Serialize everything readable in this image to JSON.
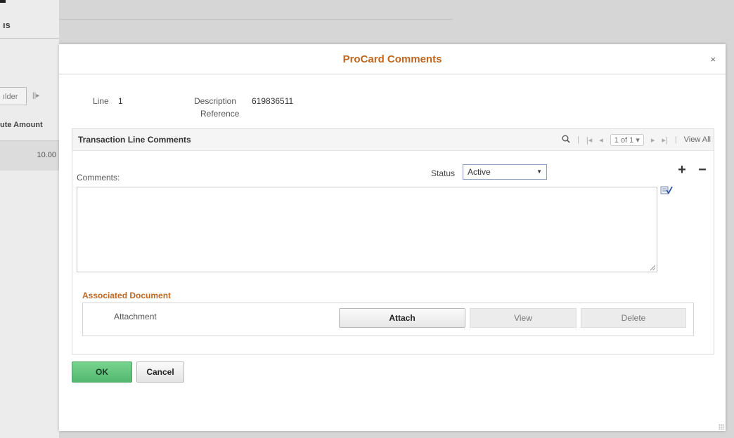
{
  "background": {
    "page_title": "ıs",
    "tab_label": "ılder",
    "tab_icon": "||▸",
    "column_header": "ute Amount",
    "row_value": "10.00"
  },
  "modal": {
    "title": "ProCard Comments",
    "close_glyph": "×",
    "line_label": "Line",
    "line_value": "1",
    "description_label": "Description",
    "description_value": "619836511",
    "reference_label": "Reference",
    "grid": {
      "title": "Transaction Line Comments",
      "pager": {
        "first": "|◂",
        "prev": "◂",
        "count": "1 of 1",
        "count_caret": "▾",
        "next": "▸",
        "last": "▸|",
        "view_all": "View All"
      },
      "comments_label": "Comments:",
      "status_label": "Status",
      "status_value": "Active",
      "status_caret": "▼",
      "add_glyph": "+",
      "delete_glyph": "−",
      "comments_value": ""
    },
    "associated_document": {
      "title": "Associated Document",
      "attachment_label": "Attachment",
      "attach_button": "Attach",
      "view_button": "View",
      "delete_button": "Delete"
    },
    "ok_button": "OK",
    "cancel_button": "Cancel"
  },
  "colors": {
    "title_accent": "#c0661e",
    "ok_green": "#5cc177",
    "mask": "#d6d6d6"
  },
  "icons": [
    "search-icon",
    "first-page-icon",
    "prev-page-icon",
    "next-page-icon",
    "last-page-icon",
    "spell-check-icon",
    "close-icon",
    "add-row-icon",
    "delete-row-icon"
  ]
}
